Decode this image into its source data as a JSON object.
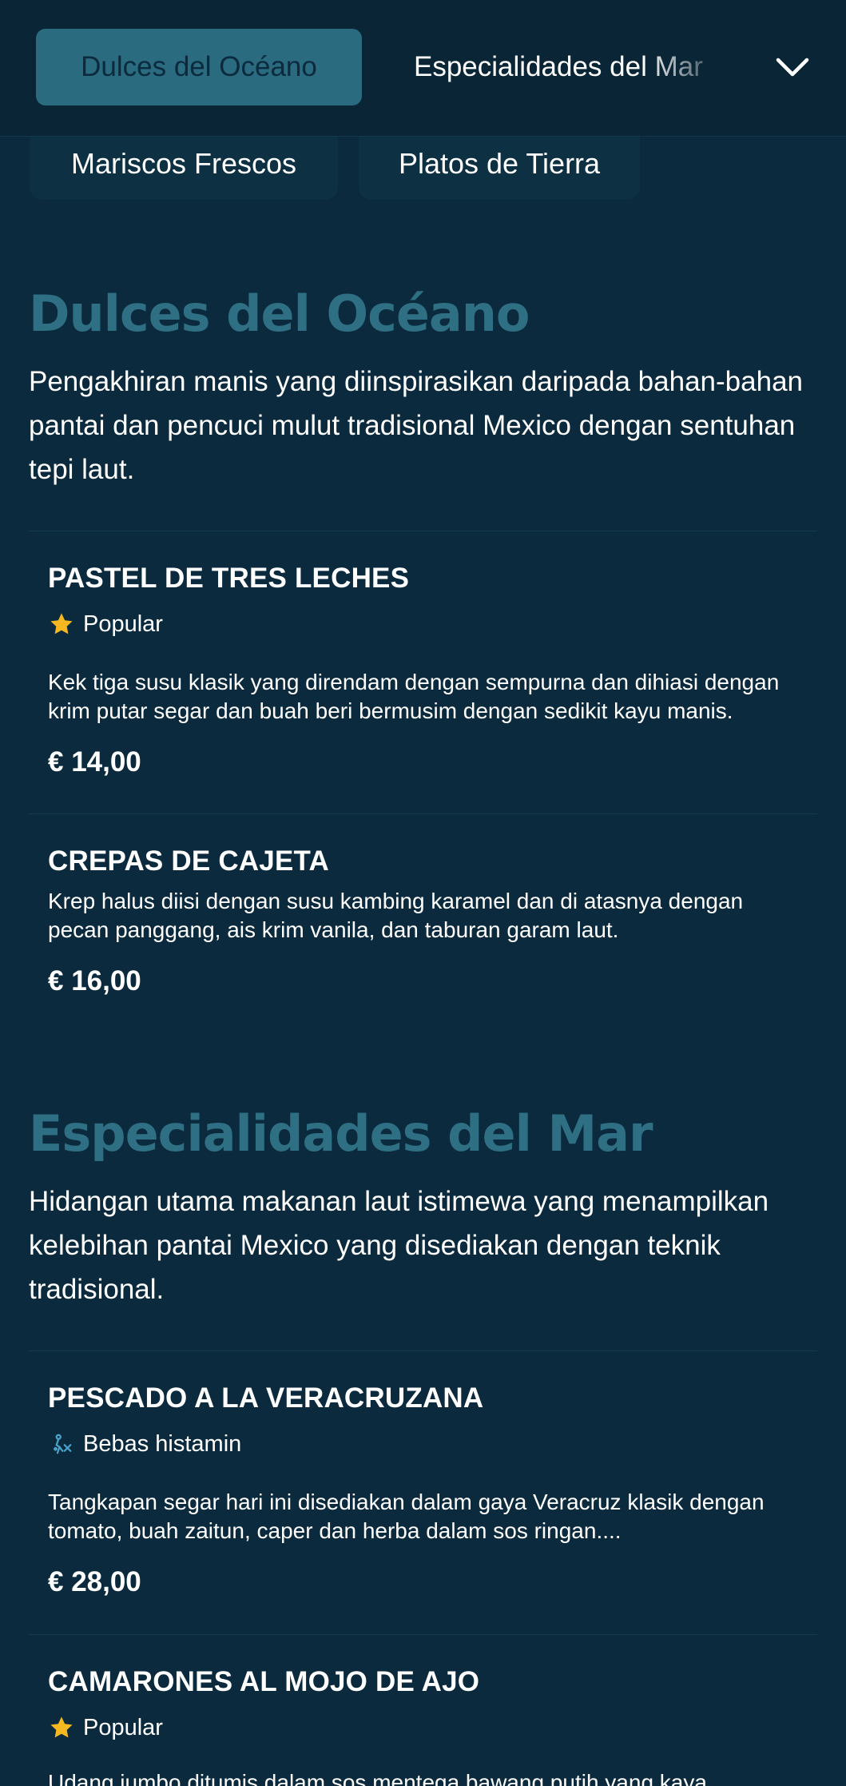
{
  "nav": {
    "active_label": "Dulces del Océano",
    "next_label": "Especialidades del Mar",
    "row2": [
      "Mariscos Frescos",
      "Platos de Tierra"
    ]
  },
  "sections": [
    {
      "title": "Dulces del Océano",
      "description": "Pengakhiran manis yang diinspirasikan daripada bahan-bahan pantai dan pencuci mulut tradisional Mexico dengan sentuhan tepi laut.",
      "items": [
        {
          "name": "PASTEL DE TRES LECHES",
          "tag": "Popular",
          "tag_icon": "star-icon",
          "description": "Kek tiga susu klasik yang direndam dengan sempurna dan dihiasi dengan krim putar segar dan buah beri bermusim dengan sedikit kayu manis.",
          "price": "€ 14,00"
        },
        {
          "name": "CREPAS DE CAJETA",
          "tag": "",
          "description": "Krep halus diisi dengan susu kambing karamel dan di atasnya dengan pecan panggang, ais krim vanila, dan taburan garam laut.",
          "price": "€ 16,00"
        }
      ]
    },
    {
      "title": "Especialidades del Mar",
      "description": "Hidangan utama makanan laut istimewa yang menampilkan kelebihan pantai Mexico yang disediakan dengan teknik tradisional.",
      "items": [
        {
          "name": "PESCADO A LA VERACRUZANA",
          "tag": "Bebas histamin",
          "tag_icon": "histamine-free-icon",
          "description": "Tangkapan segar hari ini disediakan dalam gaya Veracruz klasik dengan tomato, buah zaitun, caper dan herba dalam sos ringan....",
          "price": "€ 28,00"
        },
        {
          "name": "CAMARONES AL MOJO DE AJO",
          "tag": "Popular",
          "tag_icon": "star-icon",
          "description": "Udang jumbo ditumis dalam sos mentega bawang putih yang kaya",
          "price": ""
        }
      ]
    }
  ],
  "colors": {
    "background": "#0b2a3d",
    "nav_active": "#2a6b7f",
    "section_title": "#2e6f83",
    "star": "#f5b820",
    "histamine_icon": "#4aa3c9"
  }
}
